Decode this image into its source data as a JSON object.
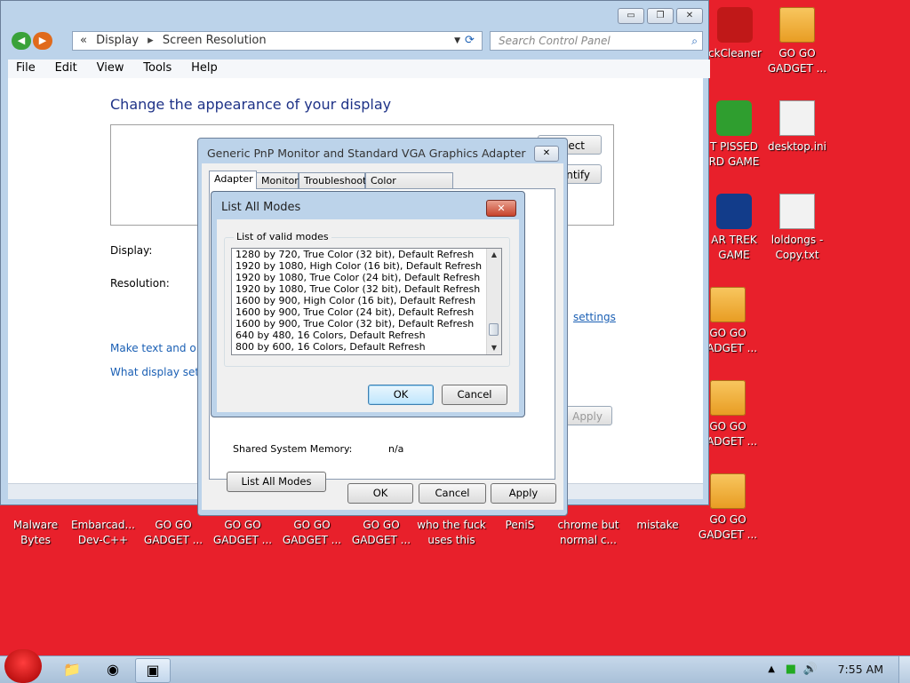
{
  "desktop": {
    "icons": [
      {
        "label1": "ckCleaner",
        "label2": "",
        "glyph": "ccleaner-icon"
      },
      {
        "label1": "GO GO",
        "label2": "GADGET ...",
        "glyph": "folder-icon"
      },
      {
        "label1": "T PISSED",
        "label2": "RD GAME",
        "glyph": "bad-piggies-icon"
      },
      {
        "label1": "desktop.ini",
        "label2": "",
        "glyph": "ini-file-icon"
      },
      {
        "label1": "AR TREK",
        "label2": "GAME",
        "glyph": "star-wars-icon"
      },
      {
        "label1": "loldongs -",
        "label2": "Copy.txt",
        "glyph": "text-file-icon"
      },
      {
        "label1": "GO GO",
        "label2": "GADGET ...",
        "glyph": "folder-icon"
      },
      {
        "label1": "GO GO",
        "label2": "GADGET ...",
        "glyph": "folder-icon"
      },
      {
        "label1": "GO GO",
        "label2": "GADGET ...",
        "glyph": "folder-icon"
      }
    ],
    "bottom_icons": [
      {
        "label1": "Malware",
        "label2": "Bytes"
      },
      {
        "label1": "Embarcad...",
        "label2": "Dev-C++"
      },
      {
        "label1": "GO GO",
        "label2": "GADGET ..."
      },
      {
        "label1": "GO GO",
        "label2": "GADGET ..."
      },
      {
        "label1": "GO GO",
        "label2": "GADGET ..."
      },
      {
        "label1": "GO GO",
        "label2": "GADGET ..."
      },
      {
        "label1": "who the fuck",
        "label2": "uses this"
      },
      {
        "label1": "PeniS",
        "label2": ""
      },
      {
        "label1": "chrome but",
        "label2": "normal c..."
      },
      {
        "label1": "mistake",
        "label2": ""
      }
    ]
  },
  "control_panel": {
    "title_buttons": {
      "minimize": "▭",
      "maximize": "❐",
      "close": "✕"
    },
    "nav": {
      "back": "◀",
      "forward": "▶"
    },
    "address": {
      "root_chevron": "«",
      "crumb1": "Display",
      "sep": "▸",
      "crumb2": "Screen Resolution",
      "dropdown": "▼",
      "refresh": "⟳"
    },
    "search_placeholder": "Search Control Panel",
    "search_icon": "⌕",
    "menu": [
      "File",
      "Edit",
      "View",
      "Tools",
      "Help"
    ],
    "heading": "Change the appearance of your display",
    "detect_button": "ect",
    "identify_button": "ntify",
    "display_label": "Display:",
    "resolution_label": "Resolution:",
    "advanced_link": "settings",
    "link_text": "Make text and o",
    "link_display": "What display set",
    "apply_button": "Apply"
  },
  "properties_dialog": {
    "title": "Generic PnP Monitor and Standard VGA Graphics Adapter Pr...",
    "close": "✕",
    "tabs": [
      "Adapter",
      "Monitor",
      "Troubleshoot",
      "Color Management"
    ],
    "shared_memory_label": "Shared System Memory:",
    "shared_memory_value": "n/a",
    "list_all_modes_button": "List All Modes",
    "ok": "OK",
    "cancel": "Cancel",
    "apply": "Apply"
  },
  "modes_dialog": {
    "title": "List All Modes",
    "close": "✕",
    "group_label": "List of valid modes",
    "modes": [
      "1280 by 720, True Color (32 bit), Default Refresh",
      "1920 by 1080, High Color (16 bit), Default Refresh",
      "1920 by 1080, True Color (24 bit), Default Refresh",
      "1920 by 1080, True Color (32 bit), Default Refresh",
      "1600 by 900, High Color (16 bit), Default Refresh",
      "1600 by 900, True Color (24 bit), Default Refresh",
      "1600 by 900, True Color (32 bit), Default Refresh",
      "640 by 480, 16 Colors, Default Refresh",
      "800 by 600, 16 Colors, Default Refresh"
    ],
    "scroll_up": "▲",
    "scroll_down": "▼",
    "ok": "OK",
    "cancel": "Cancel"
  },
  "taskbar": {
    "clock": "7:55 AM",
    "tray_up": "▲",
    "pinned": [
      "explorer-icon",
      "chrome-icon",
      "control-panel-icon"
    ]
  }
}
